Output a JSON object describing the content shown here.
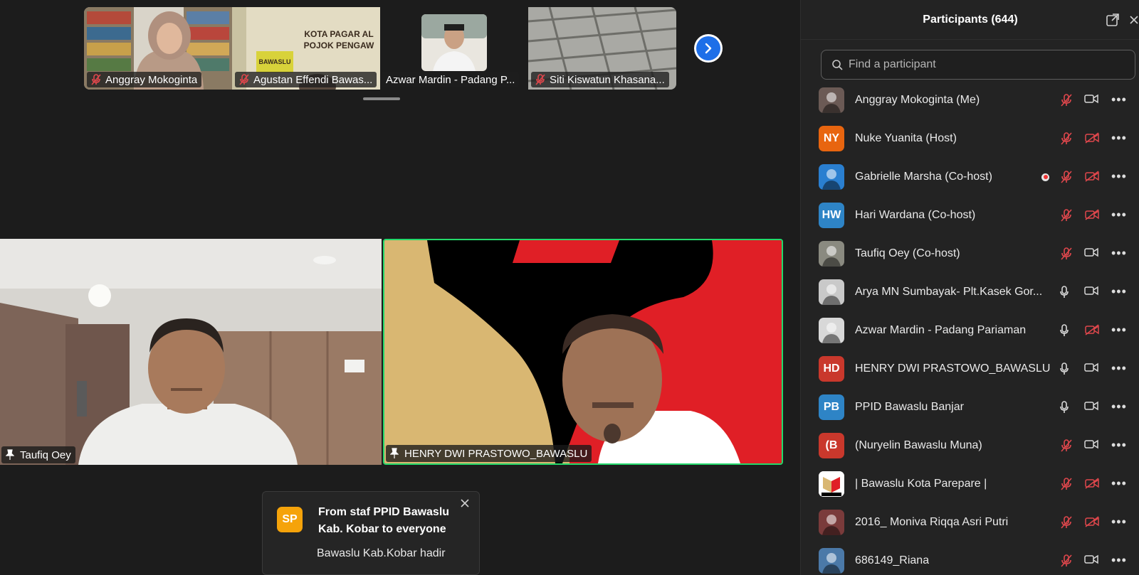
{
  "thumbnails": [
    {
      "name": "Anggray Mokoginta",
      "muted": true
    },
    {
      "name": "Agustan Effendi Bawas...",
      "muted": true
    },
    {
      "name": "Azwar Mardin - Padang P...",
      "muted": false
    },
    {
      "name": "Siti Kiswatun Khasana...",
      "muted": true
    }
  ],
  "thumb_signage": {
    "line1": "KOTA PAGAR AL",
    "line2": "POJOK PENGAW",
    "line3": "BAWASLU"
  },
  "videos": {
    "left": {
      "name": "Taufiq Oey"
    },
    "right": {
      "name": "HENRY DWI PRASTOWO_BAWASLU"
    }
  },
  "chat_toast": {
    "avatar_initials": "SP",
    "from": "From staf PPID Bawaslu Kab. Kobar to everyone",
    "message": "Bawaslu Kab.Kobar hadir"
  },
  "panel": {
    "title": "Participants (644)",
    "search_placeholder": "Find a participant",
    "participants": [
      {
        "name": "Anggray Mokoginta (Me)",
        "avatar": "photo",
        "initials": "",
        "color": "#6b5a55",
        "mic": "muted",
        "cam": "on",
        "rec": false
      },
      {
        "name": "Nuke Yuanita (Host)",
        "avatar": "initials",
        "initials": "NY",
        "color": "#e8650f",
        "mic": "muted",
        "cam": "off",
        "rec": false
      },
      {
        "name": "Gabrielle Marsha (Co-host)",
        "avatar": "photo",
        "initials": "",
        "color": "#2a7fd0",
        "mic": "muted",
        "cam": "off",
        "rec": true
      },
      {
        "name": "Hari Wardana (Co-host)",
        "avatar": "initials",
        "initials": "HW",
        "color": "#2e84c6",
        "mic": "muted",
        "cam": "off",
        "rec": false
      },
      {
        "name": "Taufiq Oey (Co-host)",
        "avatar": "photo",
        "initials": "",
        "color": "#8a8a80",
        "mic": "muted",
        "cam": "on",
        "rec": false
      },
      {
        "name": "Arya MN Sumbayak- Plt.Kasek Gor...",
        "avatar": "photo",
        "initials": "",
        "color": "#c9c9c9",
        "mic": "on",
        "cam": "on",
        "rec": false
      },
      {
        "name": "Azwar Mardin - Padang Pariaman",
        "avatar": "photo",
        "initials": "",
        "color": "#d8d8d8",
        "mic": "on",
        "cam": "off",
        "rec": false
      },
      {
        "name": "HENRY DWI PRASTOWO_BAWASLU",
        "avatar": "initials",
        "initials": "HD",
        "color": "#c9382c",
        "mic": "on",
        "cam": "on",
        "rec": false
      },
      {
        "name": "PPID  Bawaslu Banjar",
        "avatar": "initials",
        "initials": "PB",
        "color": "#2e84c6",
        "mic": "on",
        "cam": "on",
        "rec": false
      },
      {
        "name": "(Nuryelin Bawaslu Muna)",
        "avatar": "initials",
        "initials": "(B",
        "color": "#c9382c",
        "mic": "muted",
        "cam": "on",
        "rec": false
      },
      {
        "name": "| Bawaslu Kota Parepare |",
        "avatar": "logo",
        "initials": "",
        "color": "#ffffff",
        "mic": "muted",
        "cam": "off",
        "rec": false
      },
      {
        "name": "2016_ Moniva Riqqa Asri Putri",
        "avatar": "photo",
        "initials": "",
        "color": "#7a3b3b",
        "mic": "muted",
        "cam": "off",
        "rec": false
      },
      {
        "name": "686149_Riana",
        "avatar": "photo",
        "initials": "",
        "color": "#4b79a8",
        "mic": "muted",
        "cam": "on",
        "rec": false
      }
    ]
  },
  "colors": {
    "active_speaker": "#23d96b",
    "muted_icon": "#e0474c",
    "accent_blue": "#1e6fe8"
  }
}
